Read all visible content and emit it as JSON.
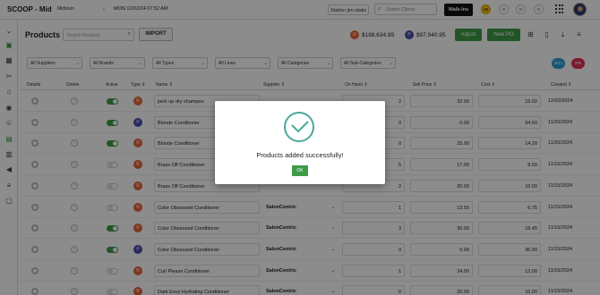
{
  "app": {
    "brand": "SCOOP - Mid",
    "location": "Midtown",
    "datetime": "MON 12/02/24  07:52 AM",
    "station": "Station jim statio",
    "search_clients_placeholder": "Search Clients",
    "walkin_label": "Walk-Ins",
    "badge_count": "26",
    "counter_icons": [
      "0",
      "0",
      "0"
    ]
  },
  "page": {
    "title": "Products",
    "search_placeholder": "Search Products",
    "import_label": "IMPORT",
    "retail_badge": "R",
    "retail_total": "$188,634.99",
    "pro_badge": "P",
    "pro_total": "$97,940.95",
    "adjust_label": "Adjust",
    "new_po_label": "New PO"
  },
  "filters": [
    "All Suppliers",
    "All Brands",
    "All Types",
    "All Lines",
    "All Categories",
    "All Sub-Categories"
  ],
  "pills": [
    {
      "label": "3011",
      "color": "#2a9fd6"
    },
    {
      "label": "295",
      "color": "#e0315a"
    }
  ],
  "table": {
    "headers": [
      "Details",
      "Delete",
      "Active",
      "Type ⇕",
      "Name ⇕",
      "Supplier ⇕",
      "On Hand ⇕",
      "Sell Price ⇕",
      "Cost ⇕",
      "Created ⇕"
    ],
    "rows": [
      {
        "active": true,
        "type": "R",
        "name": "perk up dry shampoo",
        "supplier": "",
        "on_hand": "2",
        "sell": "32.00",
        "cost": "15.02",
        "created": "12/02/2024"
      },
      {
        "active": true,
        "type": "P",
        "name": "Blonde Conditioner",
        "supplier": "",
        "on_hand": "0",
        "sell": "0.00",
        "cost": "94.50",
        "created": "11/20/2024"
      },
      {
        "active": true,
        "type": "R",
        "name": "Blonde Conditioner",
        "supplier": "",
        "on_hand": "0",
        "sell": "25.00",
        "cost": "14.20",
        "created": "11/20/2024"
      },
      {
        "active": false,
        "type": "R",
        "name": "Brass Off Conditioner",
        "supplier": "",
        "on_hand": "5",
        "sell": "17.00",
        "cost": "8.50",
        "created": "11/15/2024"
      },
      {
        "active": false,
        "type": "R",
        "name": "Brass Off Conditioner",
        "supplier": "",
        "on_hand": "2",
        "sell": "20.00",
        "cost": "10.00",
        "created": "11/15/2024"
      },
      {
        "active": false,
        "type": "R",
        "name": "Color Obsessed Conditioner",
        "supplier": "SalonCentric",
        "on_hand": "1",
        "sell": "13.50",
        "cost": "6.75",
        "created": "11/15/2024"
      },
      {
        "active": true,
        "type": "R",
        "name": "Color Obsessed Conditioner",
        "supplier": "SalonCentric",
        "on_hand": "3",
        "sell": "36.00",
        "cost": "18.45",
        "created": "11/15/2024"
      },
      {
        "active": true,
        "type": "P",
        "name": "Color Obsessed Conditioner",
        "supplier": "SalonCentric",
        "on_hand": "0",
        "sell": "0.00",
        "cost": "36.90",
        "created": "11/15/2024"
      },
      {
        "active": false,
        "type": "R",
        "name": "Curl Please Conditioner",
        "supplier": "SalonCentric",
        "on_hand": "1",
        "sell": "24.00",
        "cost": "12.00",
        "created": "11/15/2024"
      },
      {
        "active": false,
        "type": "R",
        "name": "Dark Envy Hydrating Conditioner",
        "supplier": "SalonCentric",
        "on_hand": "0",
        "sell": "20.00",
        "cost": "10.00",
        "created": "11/15/2024"
      }
    ]
  },
  "modal": {
    "message": "Products added successfully!",
    "ok_label": "OK"
  },
  "colors": {
    "accent_green": "#3f9b45",
    "retail_orange": "#e8633a",
    "pro_purple": "#4a4fa8",
    "check_teal": "#4aa89a"
  }
}
